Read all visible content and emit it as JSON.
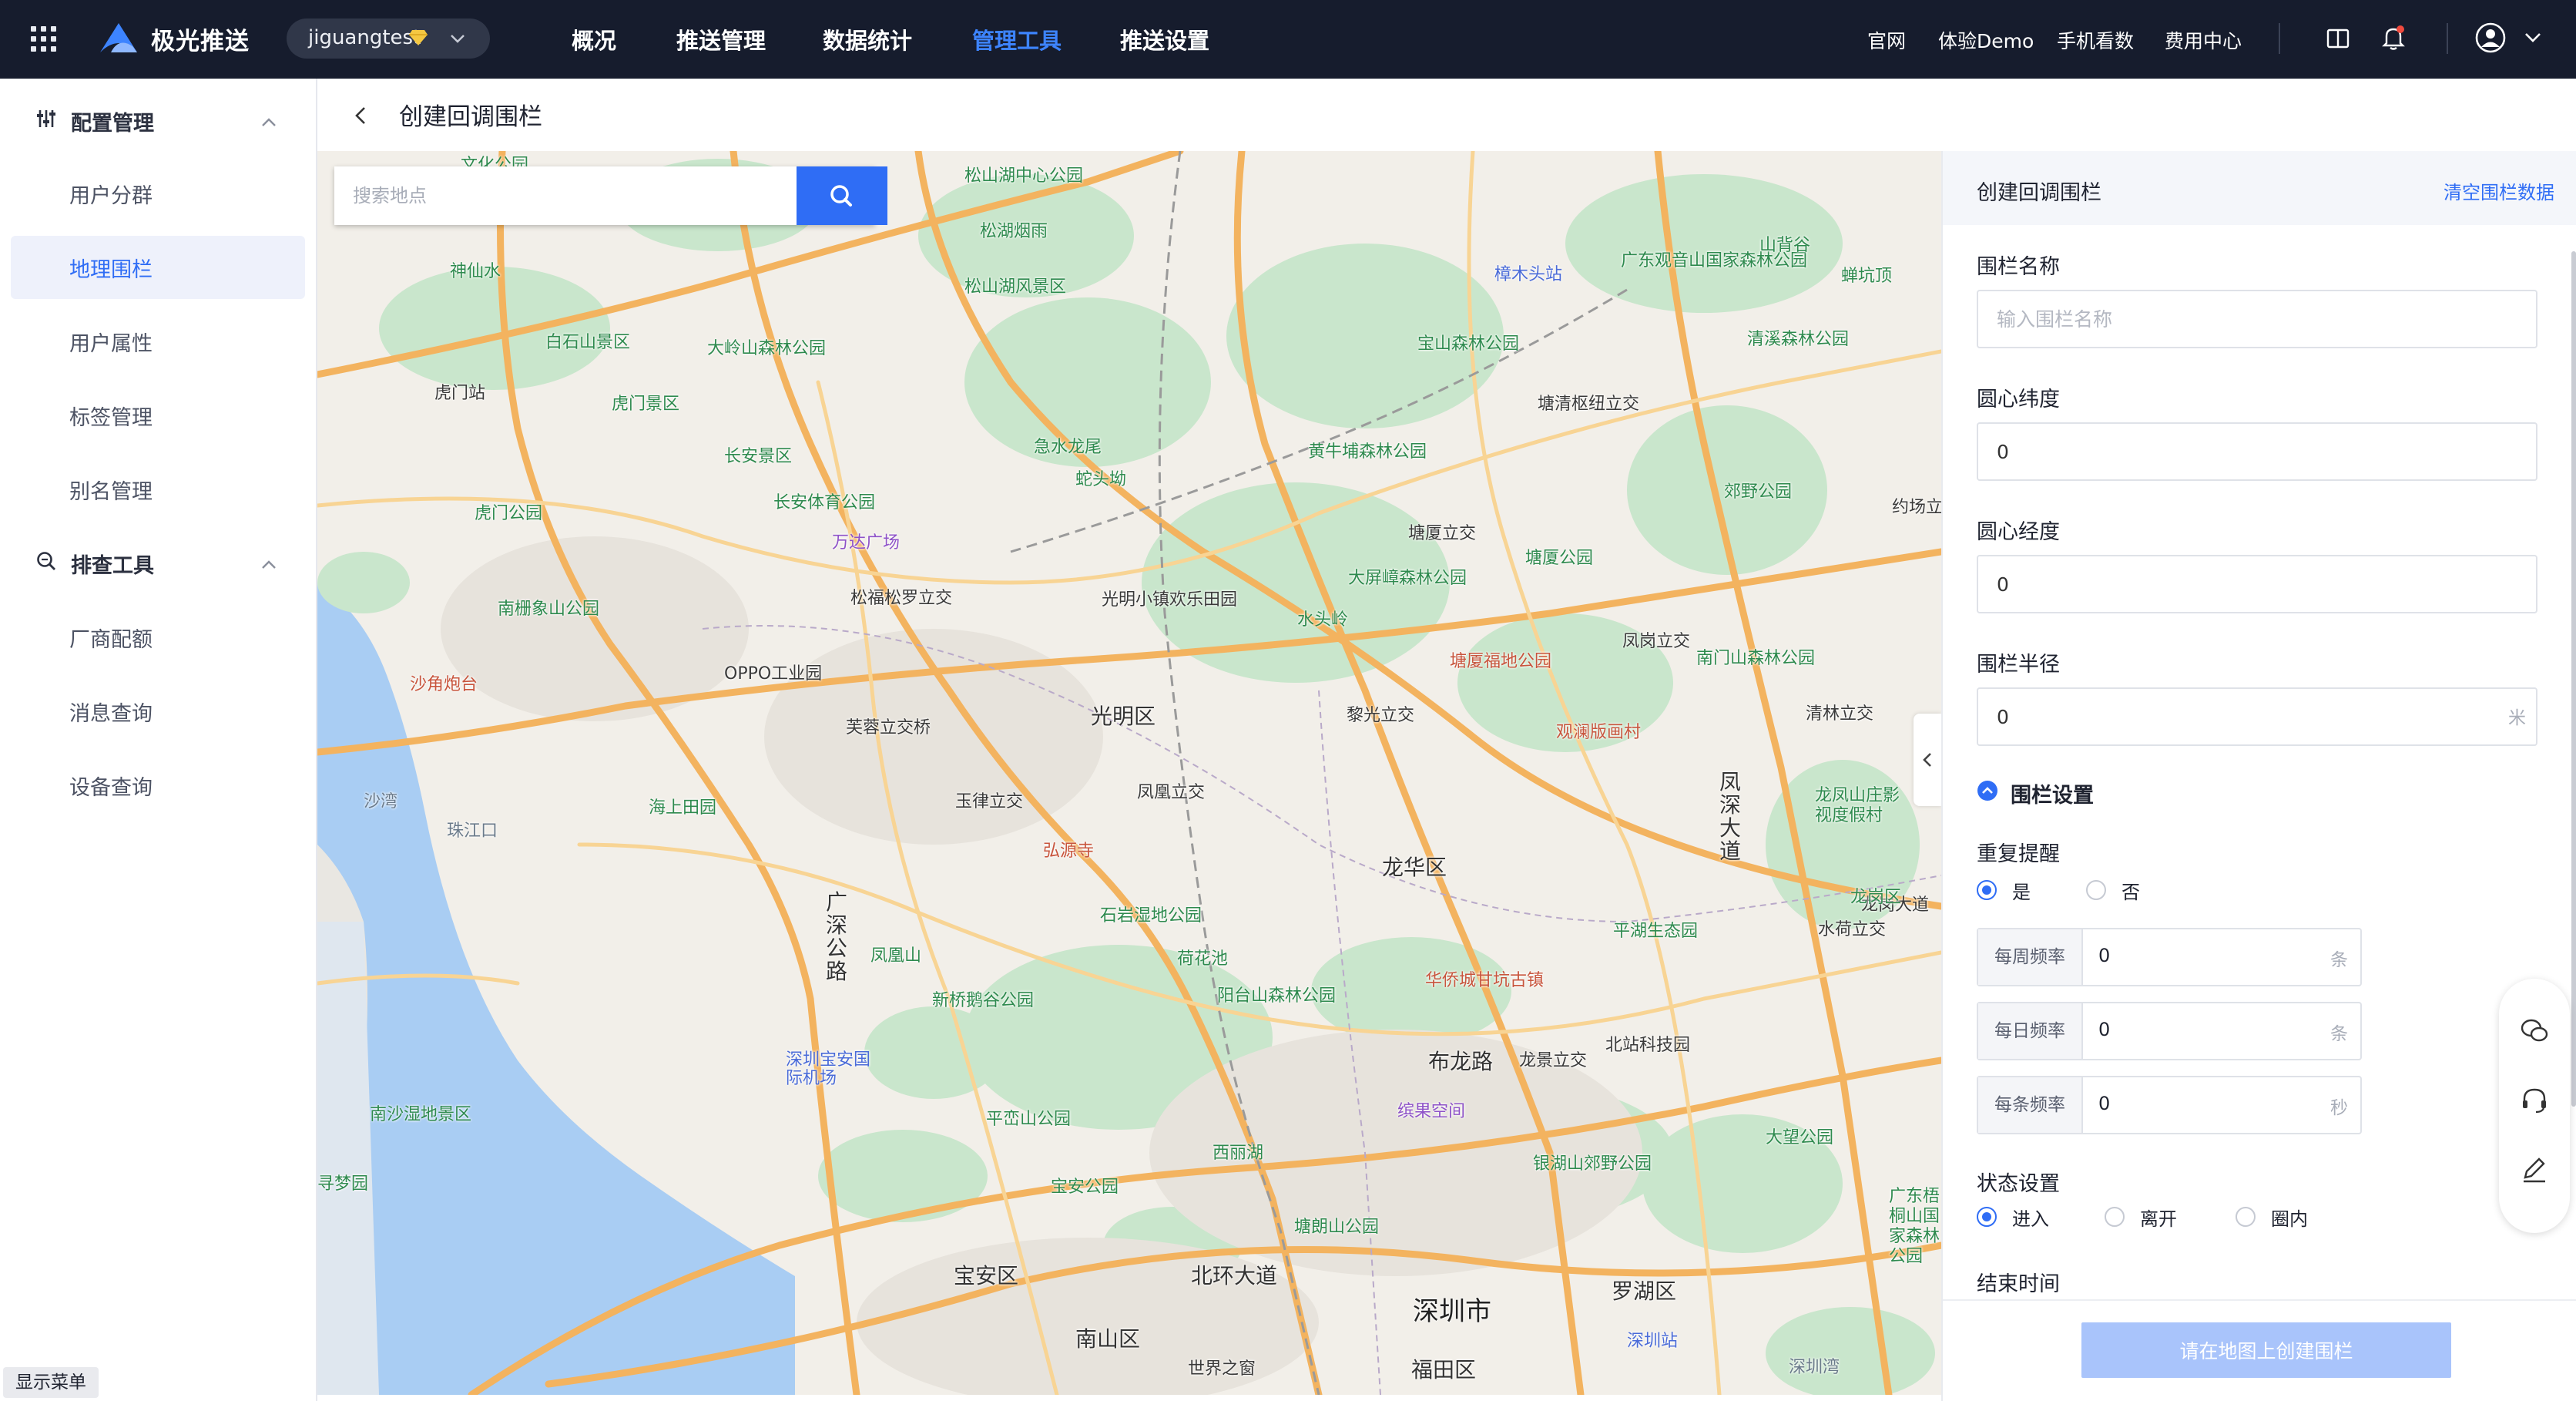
{
  "topbar": {
    "brand": "极光推送",
    "account": "jiguangtest",
    "nav": [
      {
        "label": "概况"
      },
      {
        "label": "推送管理"
      },
      {
        "label": "数据统计"
      },
      {
        "label": "管理工具",
        "active": true
      },
      {
        "label": "推送设置"
      }
    ],
    "links": [
      "官网",
      "体验Demo",
      "手机看数",
      "费用中心"
    ]
  },
  "sidebar": {
    "groups": [
      {
        "label": "配置管理",
        "items": [
          {
            "label": "用户分群"
          },
          {
            "label": "地理围栏",
            "active": true
          },
          {
            "label": "用户属性"
          },
          {
            "label": "标签管理"
          },
          {
            "label": "别名管理"
          }
        ]
      },
      {
        "label": "排查工具",
        "items": [
          {
            "label": "厂商配额"
          },
          {
            "label": "消息查询"
          },
          {
            "label": "设备查询"
          }
        ]
      }
    ],
    "show_menu": "显示菜单"
  },
  "page": {
    "title": "创建回调围栏"
  },
  "map": {
    "search_placeholder": "搜索地点",
    "labels": {
      "districts": [
        "光明区",
        "龙华区",
        "宝安区",
        "南山区",
        "福田区",
        "罗湖区"
      ],
      "city": "深圳市",
      "places": [
        "松山湖中心公园",
        "松湖烟雨",
        "松山湖风景区",
        "大岭山森林公园",
        "白石山景区",
        "虎门站",
        "虎门景区",
        "长安景区",
        "长安体育公园",
        "万达广场",
        "虎门公园",
        "南栅象山公园",
        "沙角炮台",
        "OPPO工业园",
        "急水龙尾",
        "蛇头坳",
        "松福松罗立交",
        "光明小镇欢乐田园",
        "黄牛埔森林公园",
        "宝山森林公园",
        "樟木头站",
        "广东观音山国家森林公园",
        "山背谷",
        "蝉坑顶",
        "清溪森林公园",
        "塘清枢纽立交",
        "郊野公园",
        "约场立交",
        "塘厦立交",
        "大屏嶂森林公园",
        "水头岭",
        "塘厦公园",
        "塘厦福地公园",
        "凤岗立交",
        "南门山森林公园",
        "黎光立交",
        "观澜版画村",
        "清林立交",
        "芙蓉立交桥",
        "玉律立交",
        "凤凰立交",
        "弘源寺",
        "海上田园",
        "石岩湿地公园",
        "荷花池",
        "凤凰山",
        "新桥鹅谷公园",
        "阳台山森林公园",
        "华侨城甘坑古镇",
        "平湖生态园",
        "龙岗大道",
        "深圳宝安国际机场",
        "平峦山公园",
        "西丽湖",
        "缤果空间",
        "布龙路",
        "龙景立交",
        "北站科技园",
        "大望公园",
        "宝安公园",
        "银湖山郊野公园",
        "塘朗山公园",
        "北环大道",
        "世界之窗",
        "深圳站",
        "南沙湿地景区",
        "寻梦园",
        "神仙水",
        "文化公园",
        "沙湾",
        "珠江口",
        "深圳湾",
        "广深公路",
        "凤深大道",
        "龙凤山庄影视度假村",
        "水荷立交",
        "龙岗区",
        "广东梧桐山国家森林公园"
      ]
    }
  },
  "panel": {
    "title": "创建回调围栏",
    "clear": "清空围栏数据",
    "fields": {
      "name": {
        "label": "围栏名称",
        "placeholder": "输入围栏名称",
        "value": ""
      },
      "lat": {
        "label": "圆心纬度",
        "value": "0"
      },
      "lng": {
        "label": "圆心经度",
        "value": "0"
      },
      "radius": {
        "label": "围栏半径",
        "value": "0",
        "unit": "米"
      }
    },
    "settings_title": "围栏设置",
    "repeat": {
      "label": "重复提醒",
      "options": [
        "是",
        "否"
      ],
      "selected": "是"
    },
    "freq": [
      {
        "label": "每周频率",
        "value": "0",
        "unit": "条"
      },
      {
        "label": "每日频率",
        "value": "0",
        "unit": "条"
      },
      {
        "label": "每条频率",
        "value": "0",
        "unit": "秒"
      }
    ],
    "status": {
      "label": "状态设置",
      "options": [
        "进入",
        "离开",
        "圈内"
      ],
      "selected": "进入"
    },
    "end_time": "结束时间",
    "submit": "请在地图上创建围栏"
  },
  "colors": {
    "accent": "#2f6df5",
    "topbar": "#161c2d",
    "active_nav": "#3d84ff",
    "submit_disabled": "#a9c4fb"
  }
}
